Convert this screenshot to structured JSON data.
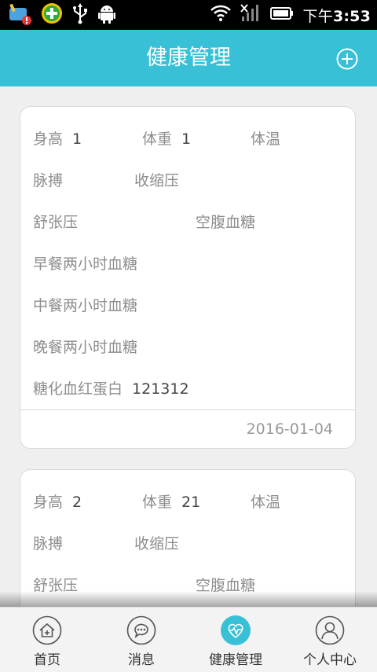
{
  "status_bar": {
    "time_prefix": "下午",
    "time": "3:53",
    "icons": [
      "broom-icon",
      "plus-badge-icon",
      "usb-icon",
      "android-icon",
      "wifi-icon",
      "signal-icon",
      "battery-icon"
    ]
  },
  "header": {
    "title": "健康管理",
    "add_icon": "plus-circle-icon"
  },
  "records": [
    {
      "height_label": "身高",
      "height_value": "1",
      "weight_label": "体重",
      "weight_value": "1",
      "temp_label": "体温",
      "pulse_label": "脉搏",
      "systolic_label": "收缩压",
      "diastolic_label": "舒张压",
      "fasting_label": "空腹血糖",
      "breakfast_label": "早餐两小时血糖",
      "lunch_label": "中餐两小时血糖",
      "dinner_label": "晚餐两小时血糖",
      "hba1c_label": "糖化血红蛋白",
      "hba1c_value": "121312",
      "date": "2016-01-04"
    },
    {
      "height_label": "身高",
      "height_value": "2",
      "weight_label": "体重",
      "weight_value": "21",
      "temp_label": "体温",
      "pulse_label": "脉搏",
      "systolic_label": "收缩压",
      "diastolic_label": "舒张压",
      "fasting_label": "空腹血糖"
    }
  ],
  "tabs": [
    {
      "label": "首页",
      "icon": "home-icon",
      "active": false
    },
    {
      "label": "消息",
      "icon": "message-icon",
      "active": false
    },
    {
      "label": "健康管理",
      "icon": "heart-pulse-icon",
      "active": true
    },
    {
      "label": "个人中心",
      "icon": "user-icon",
      "active": false
    }
  ],
  "colors": {
    "accent": "#37c0d6",
    "card_border": "#d9d9d9",
    "label_gray": "#8e8e8e"
  }
}
